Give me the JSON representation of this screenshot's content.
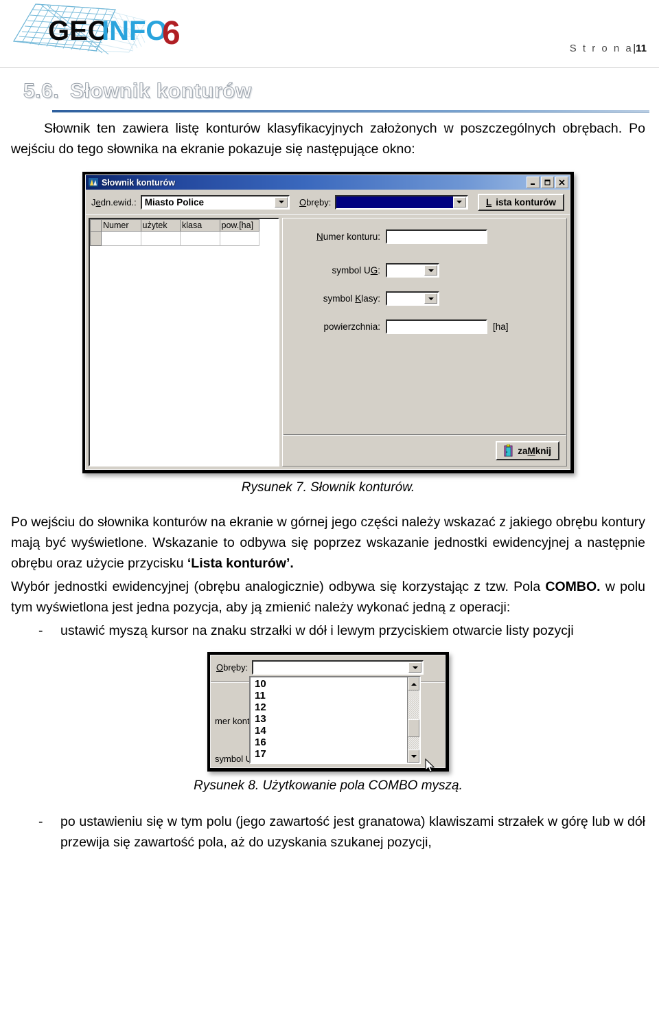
{
  "header": {
    "logo_geo": "GEO",
    "logo_info": "INFO",
    "logo_six": "6",
    "page_label": "S t r o n a",
    "page_bar": "|",
    "page_number": "11",
    "colors": {
      "logo_geo": "#0a0a0a",
      "logo_info": "#2aa4dd",
      "logo_six": "#b01f24",
      "grid_mesh": "#6fb7d8",
      "rule": "#d9d9d9"
    }
  },
  "section": {
    "number": "5.6.",
    "title": "Słownik konturów",
    "rule_color": "#2e5f9e"
  },
  "intro_paragraph": "Słownik ten zawiera listę konturów klasyfikacyjnych założonych w poszczególnych obrębach. Po wejściu do tego słownika na ekranie pokazuje się następujące okno:",
  "figure1": {
    "caption": "Rysunek 7. Słownik konturów.",
    "window": {
      "title": "Słownik konturów",
      "title_icon": "app-icon",
      "buttons": {
        "minimize": "minimize-icon",
        "maximize": "maximize-icon",
        "close": "close-icon"
      },
      "toolbar": {
        "jedn_label_pre": "J",
        "jedn_label_accel": "e",
        "jedn_label_post": "dn.ewid.:",
        "jedn_label_full": "Jedn.ewid.:",
        "jedn_value": "Miasto Police",
        "obreby_label_accel": "O",
        "obreby_label_post": "bręby:",
        "obreby_label_full": "Obręby:",
        "obreby_value": "",
        "lista_button_accel": "L",
        "lista_button_post": "ista konturów",
        "lista_button_full": "Lista konturów"
      },
      "grid": {
        "columns": [
          "Numer",
          "użytek",
          "klasa",
          "pow.[ha]"
        ],
        "rows": [
          [
            "",
            "",
            "",
            ""
          ]
        ]
      },
      "form": {
        "numer_label_accel": "N",
        "numer_label_post": "umer konturu:",
        "numer_label_full": "Numer konturu:",
        "numer_value": "",
        "symbol_ug_label_pre": "symbol U",
        "symbol_ug_label_accel": "G",
        "symbol_ug_label_post": ":",
        "symbol_ug_label_full": "symbol UG:",
        "symbol_ug_value": "",
        "symbol_klasy_label_pre": "symbol ",
        "symbol_klasy_label_accel": "K",
        "symbol_klasy_label_post": "lasy:",
        "symbol_klasy_label_full": "symbol Klasy:",
        "symbol_klasy_value": "",
        "powierzchnia_label": "powierzchnia:",
        "powierzchnia_value": "",
        "powierzchnia_unit": "[ha]"
      },
      "close_button": {
        "pre": "za",
        "accel": "M",
        "post": "knij",
        "full": "zaMknij",
        "icon": "door-exit-icon"
      }
    }
  },
  "paragraph2_part1": "Po wejściu do słownika konturów na ekranie w górnej jego części należy wskazać z jakiego obrębu kontury mają być wyświetlone. Wskazanie to odbywa się poprzez wskazanie jednostki ewidencyjnej a następnie obrębu oraz użycie przycisku ",
  "paragraph2_bold": "‘Lista konturów’.",
  "paragraph3_part1": "Wybór jednostki ewidencyjnej (obrębu analogicznie) odbywa się korzystając z tzw. Pola ",
  "paragraph3_bold": "COMBO.",
  "paragraph3_part2": " w polu tym wyświetlona jest jedna pozycja, aby ją zmienić należy wykonać jedną z operacji:",
  "bullet1": {
    "dash": "-",
    "text": "ustawić myszą kursor na znaku strzałki w dół i lewym przyciskiem otwarcie listy pozycji"
  },
  "figure2": {
    "caption": "Rysunek 8. Użytkowanie pola COMBO myszą.",
    "obreby_label_accel": "O",
    "obreby_label_post": "bręby:",
    "obreby_label_full": "Obręby:",
    "obreby_value": "",
    "ghost_label_1": "mer kontur",
    "ghost_label_2": "symbol U",
    "items": [
      "10",
      "11",
      "12",
      "13",
      "14",
      "16",
      "17"
    ]
  },
  "bullet2": {
    "dash": "-",
    "text": "po ustawieniu się w tym polu (jego zawartość jest granatowa) klawiszami strzałek w górę lub w dół przewija się zawartość pola, aż do uzyskania szukanej pozycji,"
  }
}
